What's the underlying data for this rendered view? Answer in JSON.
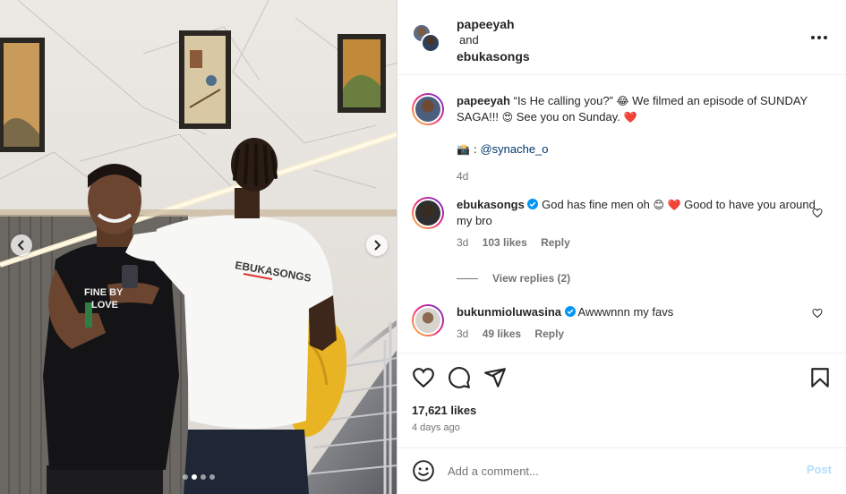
{
  "header": {
    "user1": "papeeyah",
    "and_label": "and",
    "user2": "ebukasongs",
    "more_label": "•••"
  },
  "caption": {
    "username": "papeeyah",
    "text_a": "“Is He calling you?”",
    "emoji_a": "😂",
    "text_b": "We filmed an episode of SUNDAY SAGA!!!",
    "emoji_b": "😍",
    "text_c": "See you on Sunday.",
    "emoji_c": "❤️",
    "credit_prefix": "📸 :",
    "credit_handle": "@synache_o",
    "time": "4d"
  },
  "comments": [
    {
      "username": "ebukasongs",
      "verified": true,
      "text_a": "God has fine men oh",
      "emoji_a": "😊",
      "emoji_b": "❤️",
      "text_b": "Good to have you around my bro",
      "time": "3d",
      "likes": "103 likes",
      "reply": "Reply",
      "view_replies": "View replies (2)"
    },
    {
      "username": "bukunmioluwasina",
      "verified": true,
      "text_a": "Awwwnnn my favs",
      "time": "3d",
      "likes": "49 likes",
      "reply": "Reply"
    }
  ],
  "stats": {
    "likes": "17,621 likes",
    "posted": "4 days ago"
  },
  "composer": {
    "placeholder": "Add a comment...",
    "post_label": "Post"
  },
  "carousel": {
    "dot_count": 4,
    "active_index": 1
  },
  "colors": {
    "link": "#00376b",
    "muted": "#737373",
    "post_disabled": "#b2dffc",
    "verified": "#0095f6"
  },
  "photo_text": {
    "shirt_right": "EBUKASONGS",
    "shirt_left_1": "FINE BY",
    "shirt_left_2": "LOVE"
  }
}
